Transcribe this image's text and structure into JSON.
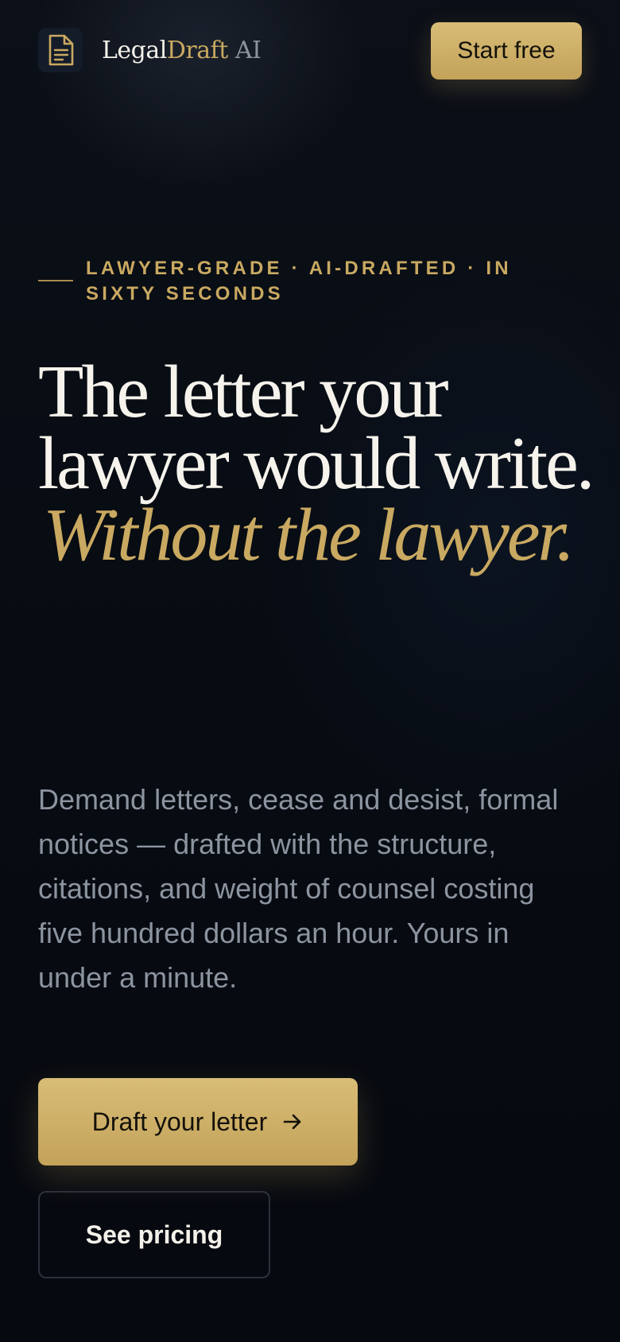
{
  "header": {
    "brand_part1": "Legal",
    "brand_part2": "Draft",
    "brand_part3": " AI",
    "logo_icon": "document-icon",
    "cta_label": "Start free"
  },
  "hero": {
    "eyebrow": "LAWYER-GRADE · AI-DRAFTED · IN SIXTY SECONDS",
    "headline_line1": "The letter your lawyer would write.",
    "headline_line2": "Without the lawyer.",
    "lead": "Demand letters, cease and desist, formal notices — drafted with the structure, citations, and weight of counsel costing five hundred dollars an hour. Yours in under a minute."
  },
  "actions": {
    "primary_label": "Draft your letter",
    "primary_icon": "arrow-right-icon",
    "secondary_label": "See pricing"
  },
  "colors": {
    "background": "#070b12",
    "accent_gold": "#c9a961",
    "text_primary": "#f6f3ec",
    "text_muted": "#8c94a0"
  }
}
